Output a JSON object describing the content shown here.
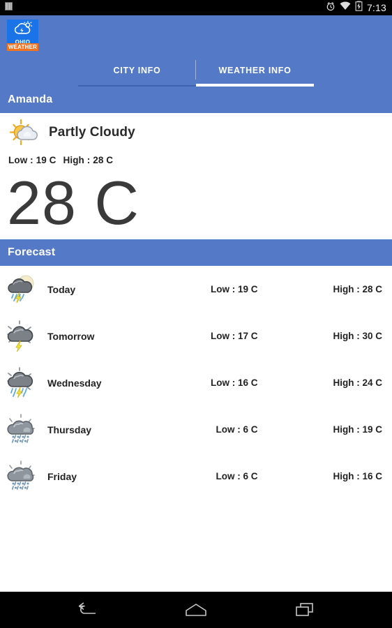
{
  "status_bar": {
    "left_icon": "sim-card-icon",
    "alarm_icon": "alarm-clock-icon",
    "wifi_icon": "wifi-icon",
    "battery_icon": "battery-charging-icon",
    "time": "7:13"
  },
  "app_bar": {
    "logo": {
      "icon": "cloud-sun-lightning-icon",
      "line1": "OHIO",
      "line2": "WEATHER"
    }
  },
  "tabs": [
    {
      "label": "CITY INFO",
      "active": false
    },
    {
      "label": "WEATHER INFO",
      "active": true
    }
  ],
  "city_section": {
    "title": "Amanda"
  },
  "current": {
    "icon": "sun-behind-cloud-icon",
    "condition": "Partly Cloudy",
    "low_label": "Low : 19 C",
    "high_label": "High : 28 C",
    "temperature": "28 C"
  },
  "forecast_section": {
    "title": "Forecast"
  },
  "forecast": [
    {
      "icon": "moon-thunderstorm-rain-icon",
      "day": "Today",
      "low": "Low : 19 C",
      "high": "High : 28 C"
    },
    {
      "icon": "thunderstorm-icon",
      "day": "Tomorrow",
      "low": "Low : 17 C",
      "high": "High : 30 C"
    },
    {
      "icon": "thunderstorm-rain-icon",
      "day": "Wednesday",
      "low": "Low : 16 C",
      "high": "High : 24 C"
    },
    {
      "icon": "rain-sleet-cloud-icon",
      "day": "Thursday",
      "low": "Low : 6 C",
      "high": "High : 19 C"
    },
    {
      "icon": "rain-sleet-cloud-icon",
      "day": "Friday",
      "low": "Low : 6 C",
      "high": "High : 16 C"
    }
  ],
  "nav_bar": {
    "back": "back-icon",
    "home": "home-icon",
    "recents": "recents-icon"
  },
  "colors": {
    "accent_blue": "#5479C7",
    "logo_blue": "#1a74e8",
    "logo_orange": "#f4731c",
    "status_black": "#000000",
    "text_dark": "#222222",
    "big_temp": "#3a3a3a"
  }
}
